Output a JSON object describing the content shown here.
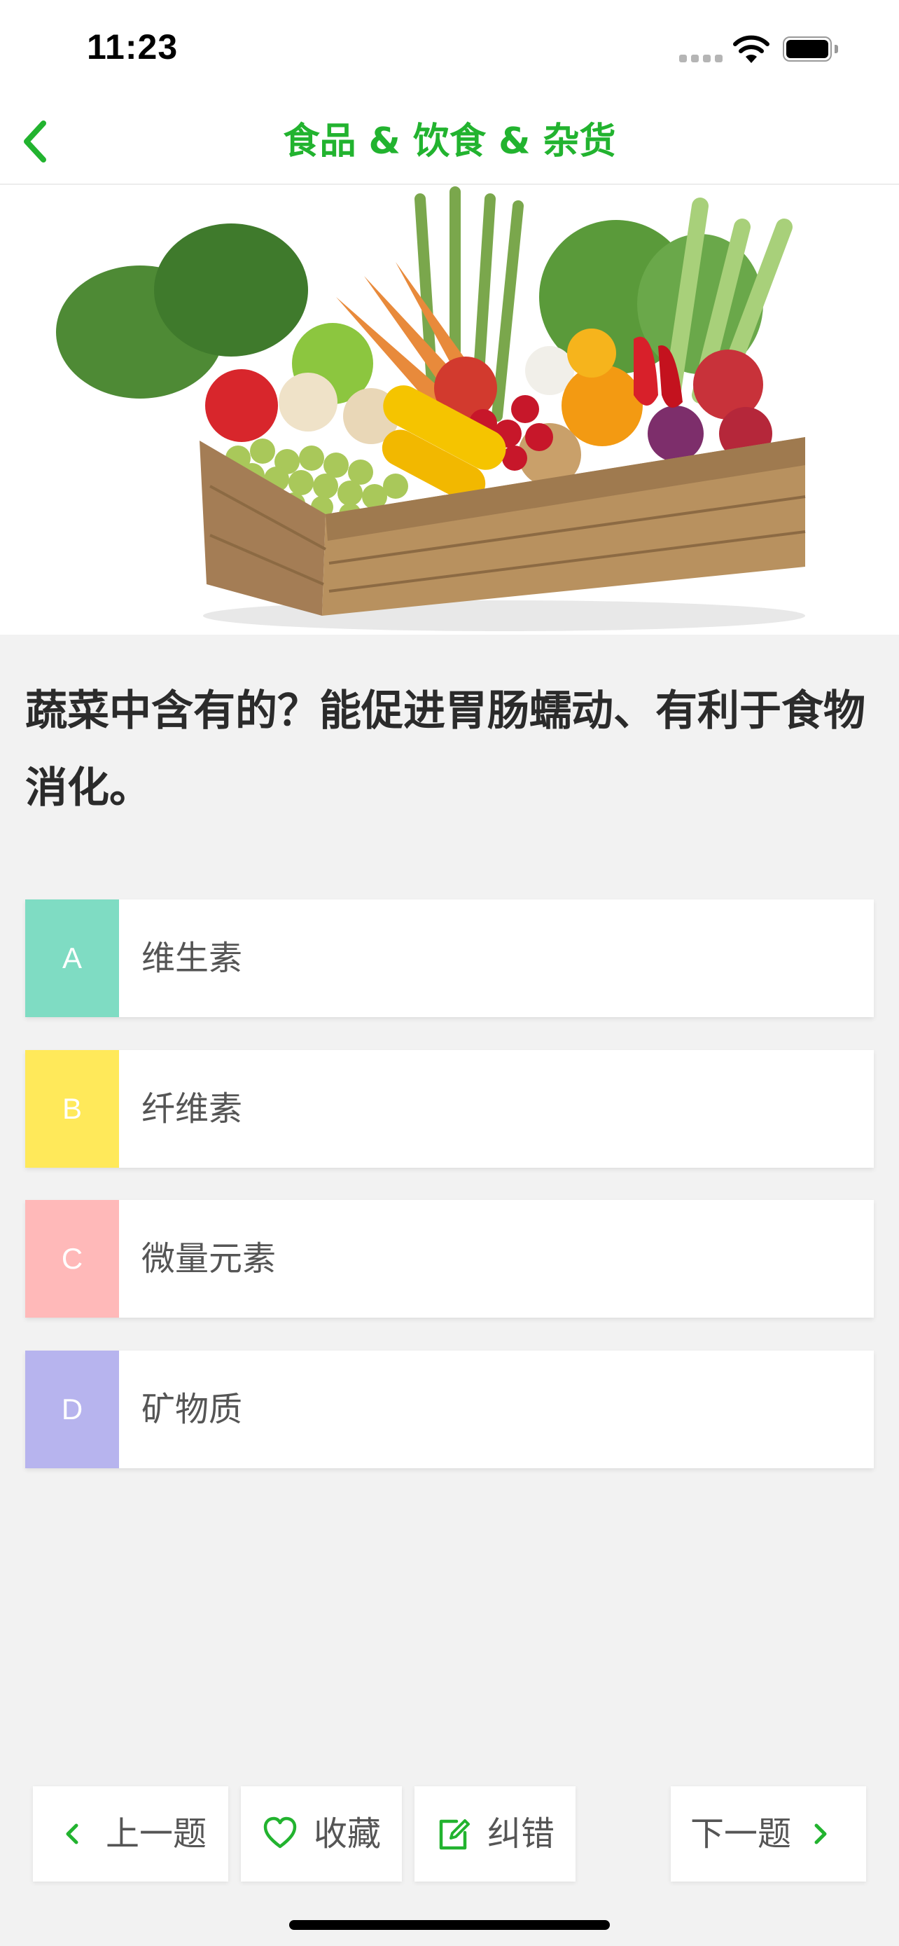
{
  "status_bar": {
    "time": "11:23"
  },
  "nav": {
    "title": "食品 & 饮食 & 杂货"
  },
  "hero": {
    "alt": "vegetables-crate-image"
  },
  "question": {
    "text": "蔬菜中含有的？能促进胃肠蠕动、有利于食物消化。"
  },
  "options": [
    {
      "letter": "A",
      "text": "维生素",
      "color": "#7fdcc3"
    },
    {
      "letter": "B",
      "text": "纤维素",
      "color": "#ffe95a"
    },
    {
      "letter": "C",
      "text": "微量元素",
      "color": "#ffb9b9"
    },
    {
      "letter": "D",
      "text": "矿物质",
      "color": "#b7b4ee"
    }
  ],
  "toolbar": {
    "prev_label": "上一题",
    "favorite_label": "收藏",
    "report_label": "纠错",
    "next_label": "下一题"
  },
  "colors": {
    "accent": "#22b32f",
    "background": "#f2f2f2"
  }
}
